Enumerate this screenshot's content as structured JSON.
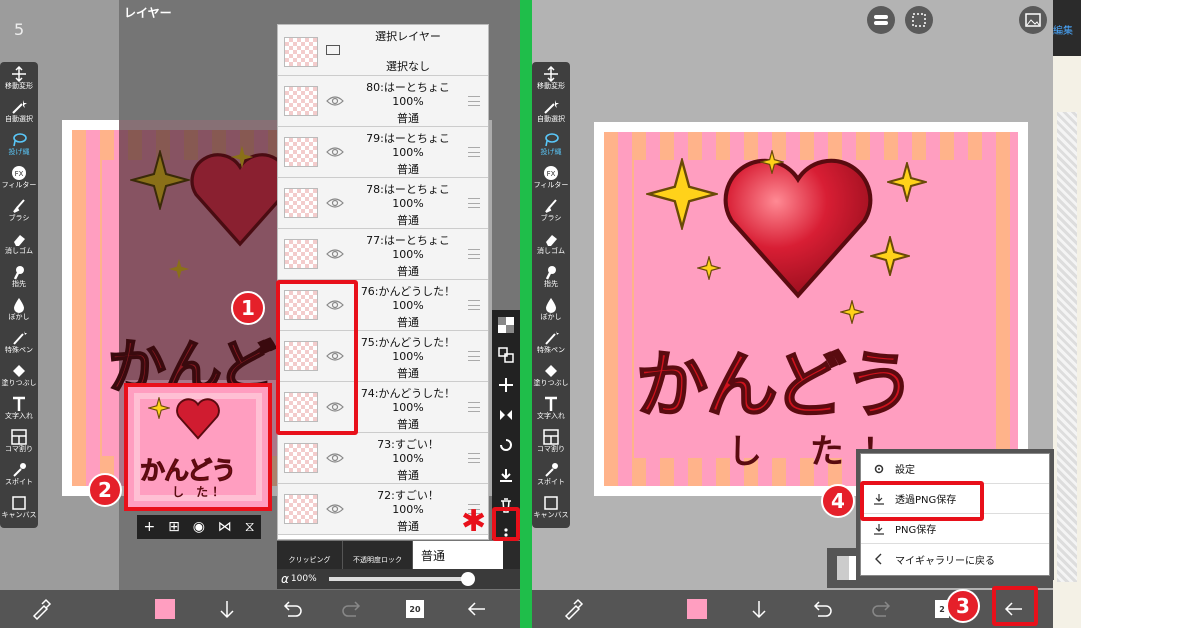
{
  "left": {
    "corner_number": "5",
    "layer_header": "レイヤー",
    "tools": [
      {
        "icon": "move-icon",
        "label": "移動変形"
      },
      {
        "icon": "magic-wand-icon",
        "label": "自動選択"
      },
      {
        "icon": "lasso-icon",
        "label": "投げ縄",
        "selected": true
      },
      {
        "icon": "fx-icon",
        "label": "フィルター"
      },
      {
        "icon": "brush-icon",
        "label": "ブラシ"
      },
      {
        "icon": "eraser-icon",
        "label": "消しゴム"
      },
      {
        "icon": "finger-icon",
        "label": "指先"
      },
      {
        "icon": "drop-icon",
        "label": "ぼかし"
      },
      {
        "icon": "special-pen-icon",
        "label": "特殊ペン"
      },
      {
        "icon": "fill-icon",
        "label": "塗りつぶし"
      },
      {
        "icon": "text-icon",
        "label": "文字入れ"
      },
      {
        "icon": "frame-icon",
        "label": "コマ割り"
      },
      {
        "icon": "eyedropper-icon",
        "label": "スポイト"
      },
      {
        "icon": "canvas-icon",
        "label": "キャンバス"
      }
    ],
    "selection_layer": {
      "name": "選択レイヤー",
      "status": "選択なし"
    },
    "layers": [
      {
        "name": "80:はーとちょこ",
        "opacity": "100%",
        "mode": "普通"
      },
      {
        "name": "79:はーとちょこ",
        "opacity": "100%",
        "mode": "普通"
      },
      {
        "name": "78:はーとちょこ",
        "opacity": "100%",
        "mode": "普通"
      },
      {
        "name": "77:はーとちょこ",
        "opacity": "100%",
        "mode": "普通"
      },
      {
        "name": "76:かんどうした！",
        "opacity": "100%",
        "mode": "普通"
      },
      {
        "name": "75:かんどうした！",
        "opacity": "100%",
        "mode": "普通"
      },
      {
        "name": "74:かんどうした！",
        "opacity": "100%",
        "mode": "普通"
      },
      {
        "name": "73:すごい！",
        "opacity": "100%",
        "mode": "普通"
      },
      {
        "name": "72:すごい！",
        "opacity": "100%",
        "mode": "普通"
      }
    ],
    "clipping_label": "クリッピング",
    "alpha_lock_label": "不透明度ロック",
    "blend_mode": "普通",
    "opacity_label": "100%",
    "badge1": "1",
    "badge2": "2",
    "asterisk": "✱",
    "art_text_big": "かんどう",
    "art_text_small": "し た！",
    "history_count": "20"
  },
  "right": {
    "edit_label": "編集",
    "tools": [
      {
        "icon": "move-icon",
        "label": "移動変形"
      },
      {
        "icon": "magic-wand-icon",
        "label": "自動選択"
      },
      {
        "icon": "lasso-icon",
        "label": "投げ縄",
        "selected": true
      },
      {
        "icon": "fx-icon",
        "label": "フィルター"
      },
      {
        "icon": "brush-icon",
        "label": "ブラシ"
      },
      {
        "icon": "eraser-icon",
        "label": "消しゴム"
      },
      {
        "icon": "finger-icon",
        "label": "指先"
      },
      {
        "icon": "drop-icon",
        "label": "ぼかし"
      },
      {
        "icon": "special-pen-icon",
        "label": "特殊ペン"
      },
      {
        "icon": "fill-icon",
        "label": "塗りつぶし"
      },
      {
        "icon": "text-icon",
        "label": "文字入れ"
      },
      {
        "icon": "frame-icon",
        "label": "コマ割り"
      },
      {
        "icon": "eyedropper-icon",
        "label": "スポイト"
      },
      {
        "icon": "canvas-icon",
        "label": "キャンバス"
      }
    ],
    "menu": [
      {
        "icon": "gear-icon",
        "label": "設定"
      },
      {
        "icon": "download-icon",
        "label": "透過PNG保存"
      },
      {
        "icon": "download-icon",
        "label": "PNG保存"
      },
      {
        "icon": "chevron-left-icon",
        "label": "マイギャラリーに戻る"
      }
    ],
    "art_text_big": "かんどう",
    "art_text_small": "し た！",
    "history_count": "2",
    "badge3": "3",
    "badge4": "4"
  },
  "colors": {
    "accent_red": "#e8101a",
    "green_divider": "#1fbe4a",
    "pink": "#ff9ec0"
  }
}
